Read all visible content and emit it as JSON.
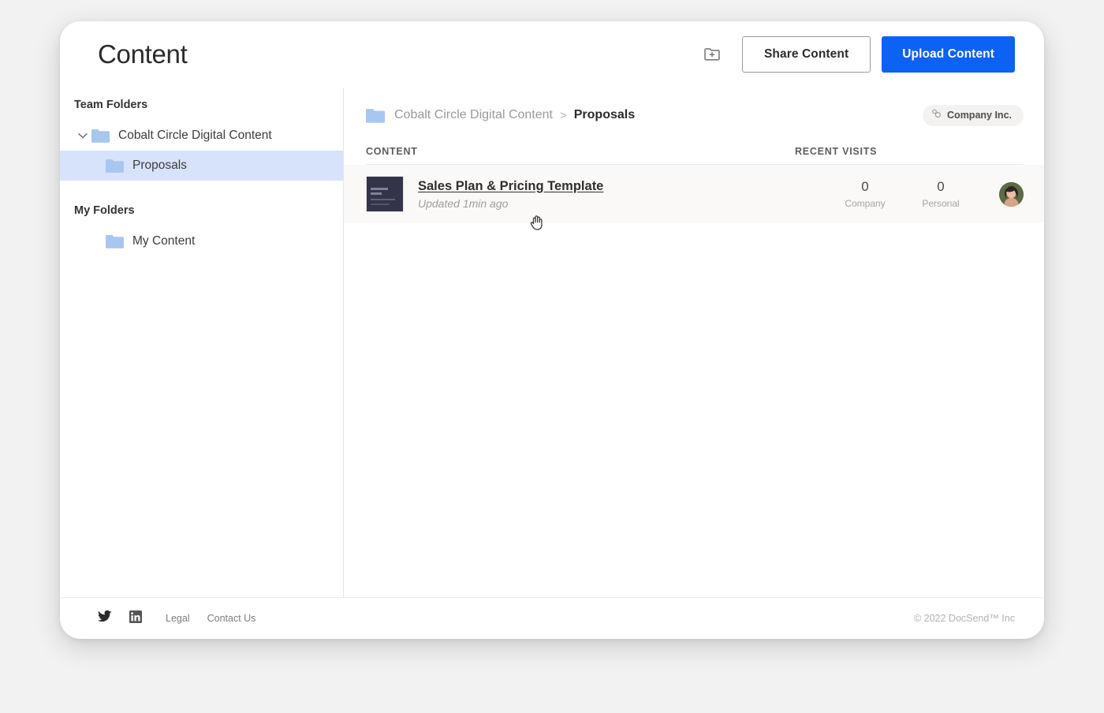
{
  "header": {
    "title": "Content",
    "new_folder_icon": "new-folder-icon",
    "share_label": "Share Content",
    "upload_label": "Upload Content",
    "primary_color": "#0c62f3"
  },
  "sidebar": {
    "team_heading": "Team Folders",
    "my_heading": "My Folders",
    "team_items": [
      {
        "label": "Cobalt Circle Digital Content",
        "icon": "folder-icon",
        "expanded": true,
        "selected": false
      },
      {
        "label": "Proposals",
        "icon": "folder-icon",
        "selected": true
      }
    ],
    "my_items": [
      {
        "label": "My Content",
        "icon": "folder-icon",
        "selected": false
      }
    ],
    "folder_color": "#a8c7f0",
    "selected_bg": "#d7e3fb"
  },
  "breadcrumb": {
    "folder_icon": "folder-icon",
    "parent": "Cobalt Circle Digital Content",
    "separator": ">",
    "current": "Proposals"
  },
  "org_pill": {
    "icon": "organization-icon",
    "label": "Company Inc."
  },
  "table": {
    "col_content": "CONTENT",
    "col_visits": "RECENT VISITS",
    "rows": [
      {
        "title": "Sales Plan & Pricing Template",
        "subtitle": "Updated 1min ago",
        "thumbnail": "document-thumbnail",
        "stats": [
          {
            "value": "0",
            "caption": "Company"
          },
          {
            "value": "0",
            "caption": "Personal"
          }
        ],
        "avatar": "user-avatar"
      }
    ]
  },
  "footer": {
    "twitter_icon": "twitter-icon",
    "linkedin_icon": "linkedin-icon",
    "links": [
      "Legal",
      "Contact Us"
    ],
    "copyright": "© 2022 DocSend™ Inc"
  },
  "cursor": {
    "type": "pointer-hand-cursor"
  }
}
